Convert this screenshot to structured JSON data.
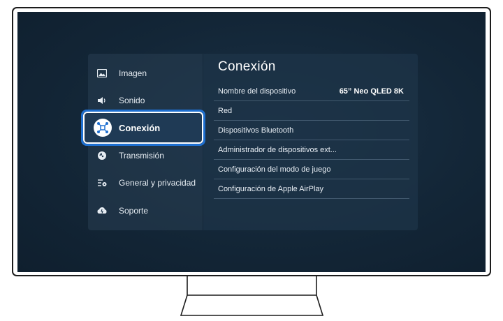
{
  "menu": {
    "items": [
      {
        "label": "Imagen",
        "icon": "picture-icon"
      },
      {
        "label": "Sonido",
        "icon": "speaker-icon"
      },
      {
        "label": "Conexión",
        "icon": "connection-icon",
        "selected": true
      },
      {
        "label": "Transmisión",
        "icon": "broadcast-icon"
      },
      {
        "label": "General y privacidad",
        "icon": "general-settings-icon"
      },
      {
        "label": "Soporte",
        "icon": "support-icon"
      }
    ]
  },
  "detail": {
    "title": "Conexión",
    "settings": [
      {
        "name": "Nombre del dispositivo",
        "value": "65” Neo QLED 8K"
      },
      {
        "name": "Red",
        "value": ""
      },
      {
        "name": "Dispositivos Bluetooth",
        "value": ""
      },
      {
        "name": "Administrador de dispositivos ext...",
        "value": ""
      },
      {
        "name": "Configuración del modo de juego",
        "value": ""
      },
      {
        "name": "Configuración de Apple AirPlay",
        "value": ""
      }
    ]
  },
  "colors": {
    "screen": "#132637",
    "focus_ring": "#1e6fd0",
    "text": "#e6ecf2"
  }
}
